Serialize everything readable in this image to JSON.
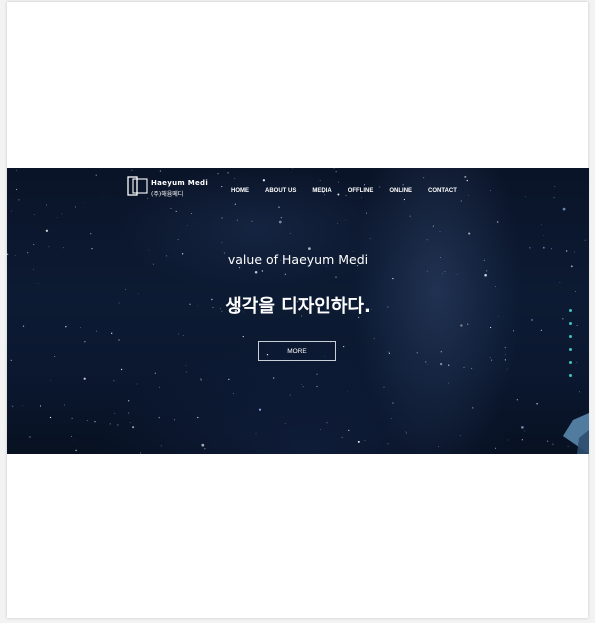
{
  "brand": {
    "name_en": "Haeyum Medi",
    "name_ko": "(주)해윰메디"
  },
  "nav": {
    "items": [
      {
        "label": "HOME"
      },
      {
        "label": "ABOUT US"
      },
      {
        "label": "MEDIA"
      },
      {
        "label": "OFFLINE"
      },
      {
        "label": "ONLINE"
      },
      {
        "label": "CONTACT"
      }
    ]
  },
  "hero": {
    "subtitle": "value of Haeyum Medi",
    "title": "생각을 디자인하다.",
    "button_label": "MORE"
  },
  "slider": {
    "dot_count": 6,
    "accent_color": "#3ec4c4"
  },
  "colors": {
    "hero_background": "#0b1830",
    "text": "#ffffff",
    "page_background": "#f3f3f3"
  }
}
